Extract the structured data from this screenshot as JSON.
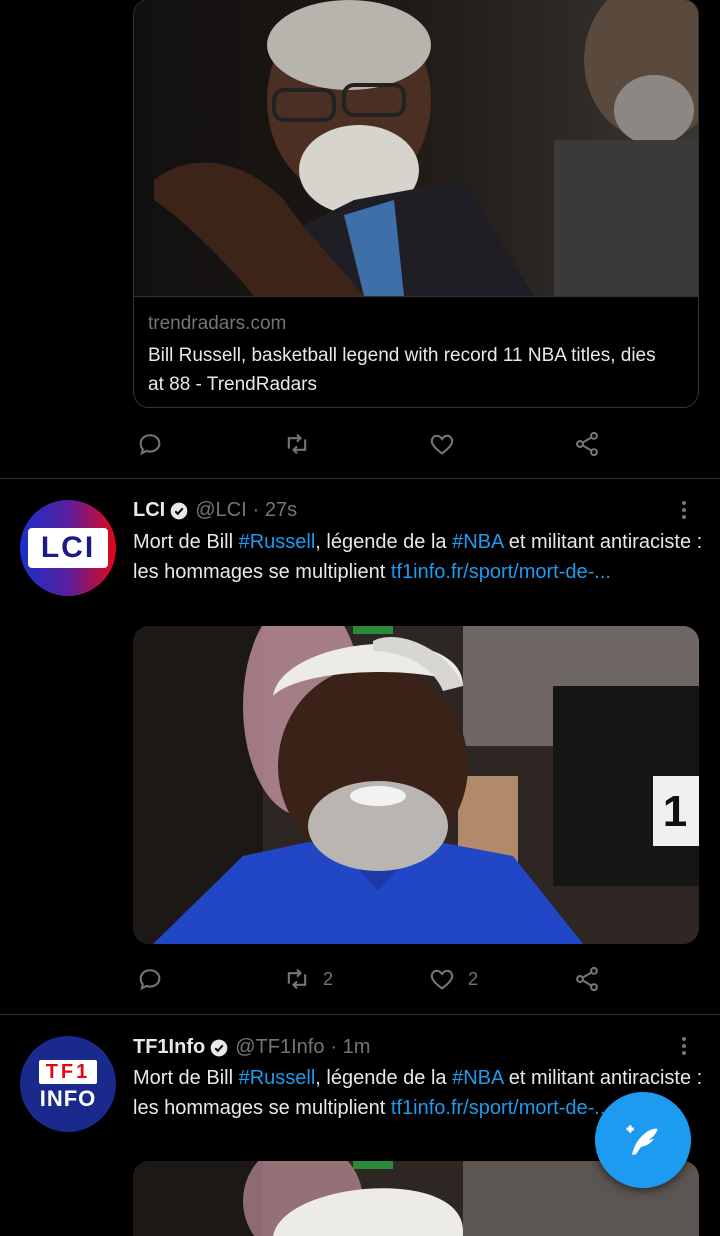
{
  "link_card": {
    "domain": "trendradars.com",
    "title": "Bill Russell, basketball legend with record 11 NBA titles, dies at 88 - TrendRadars"
  },
  "tweets": [
    {
      "avatar_text": "LCI",
      "name": "LCI",
      "handle": "@LCI",
      "time": "· 27s",
      "text_before": "Mort de Bill ",
      "hashtag1": "#Russell",
      "text_mid": ", légende de la ",
      "hashtag2": "#NBA",
      "text_after": " et militant antiraciste : les hommages se multiplient ",
      "link": "tf1info.fr/sport/mort-de-...",
      "retweets": "2",
      "likes": "2"
    },
    {
      "avatar_line1": "TF1",
      "avatar_line2": "INFO",
      "name": "TF1Info",
      "handle": "@TF1Info",
      "time": "· 1m",
      "text_before": "Mort de Bill ",
      "hashtag1": "#Russell",
      "text_mid": ", légende de la ",
      "hashtag2": "#NBA",
      "text_after": " et militant antiraciste : les hommages se multiplient ",
      "link": "tf1info.fr/sport/mort-de-..."
    }
  ],
  "colors": {
    "accent": "#1d9bf0",
    "muted": "#71767b",
    "lci_red": "#e30613",
    "tf1_blue": "#1a2a8c"
  },
  "icons": [
    "reply-icon",
    "retweet-icon",
    "like-icon",
    "share-icon",
    "verified-icon",
    "more-icon",
    "compose-icon"
  ]
}
